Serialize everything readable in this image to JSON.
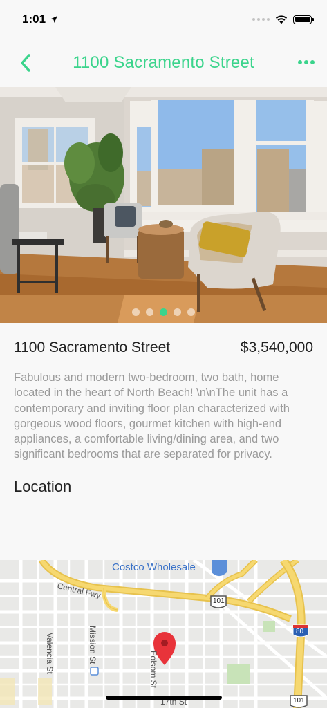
{
  "status_bar": {
    "time": "1:01"
  },
  "nav": {
    "title": "1100 Sacramento Street"
  },
  "gallery": {
    "page_count": 5,
    "active_index": 2
  },
  "listing": {
    "title": "1100 Sacramento Street",
    "price": "$3,540,000",
    "description": "Fabulous and modern two-bedroom, two bath, home located in the heart of North Beach! \\n\\nThe unit has a contemporary and inviting floor plan characterized with gorgeous wood floors, gourmet kitchen with high-end appliances, a comfortable living/dining area, and two significant bedrooms that are separated for privacy."
  },
  "location": {
    "section_title": "Location",
    "map_labels": {
      "costco": "Costco Wholesale",
      "central_fwy": "Central Fwy",
      "shield_101_a": "101",
      "shield_101_b": "101",
      "shield_80": "80",
      "valencia": "Valencia St",
      "mission": "Mission St",
      "folsom": "Folsom St",
      "seventeenth": "17th St"
    }
  },
  "colors": {
    "accent": "#3bd48c",
    "description_text": "#9a9a9a",
    "pin": "#e8333a"
  }
}
